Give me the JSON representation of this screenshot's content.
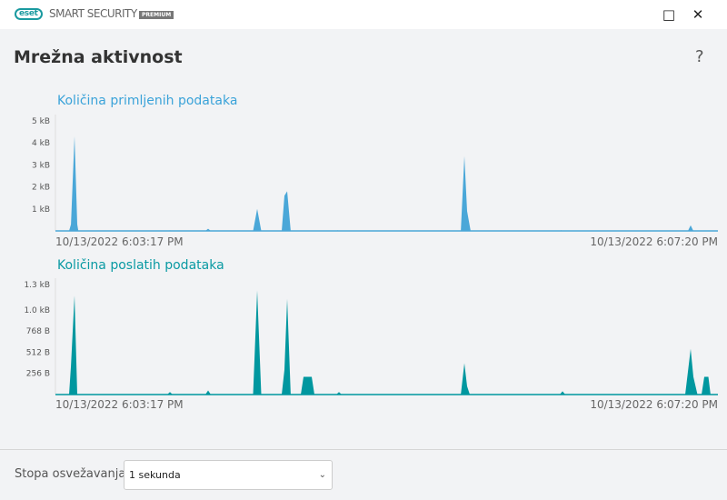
{
  "app": {
    "logo": "eset",
    "product": "SMART SECURITY",
    "edition": "PREMIUM",
    "maximize_icon": "□",
    "close_icon": "✕"
  },
  "page": {
    "title": "Mrežna aktivnost",
    "help": "?"
  },
  "footer": {
    "label": "Stopa osvežavanja",
    "select_value": "1 sekunda"
  },
  "colors": {
    "received": "#4aa7d8",
    "sent": "#00979f",
    "received_title": "#3ba3d9",
    "sent_title": "#0a9aa3"
  },
  "chart_data": [
    {
      "type": "area",
      "title": "Količina primljenih podataka",
      "unit": "kB",
      "x_unit": "seconds since start",
      "xlim": [
        0,
        243
      ],
      "ylim": [
        0,
        5
      ],
      "yticks": [
        {
          "v": 1,
          "label": "1 kB"
        },
        {
          "v": 2,
          "label": "2 kB"
        },
        {
          "v": 3,
          "label": "3 kB"
        },
        {
          "v": 4,
          "label": "4 kB"
        },
        {
          "v": 5,
          "label": "5 kB"
        }
      ],
      "x_start_label": "10/13/2022 6:03:17 PM",
      "x_end_label": "10/13/2022 6:07:20 PM",
      "points": [
        [
          0,
          0
        ],
        [
          5,
          0
        ],
        [
          5.7,
          0.3
        ],
        [
          7,
          4.3
        ],
        [
          8,
          0.3
        ],
        [
          8.4,
          0
        ],
        [
          41.5,
          0
        ],
        [
          42,
          0.03
        ],
        [
          42.5,
          0
        ],
        [
          55,
          0
        ],
        [
          56,
          0.1
        ],
        [
          57,
          0
        ],
        [
          72.5,
          0
        ],
        [
          74,
          1.0
        ],
        [
          75.5,
          0
        ],
        [
          83,
          0
        ],
        [
          84,
          1.6
        ],
        [
          85,
          1.8
        ],
        [
          86.3,
          0
        ],
        [
          103,
          0
        ],
        [
          103.5,
          0.03
        ],
        [
          104,
          0
        ],
        [
          148.7,
          0
        ],
        [
          150,
          3.4
        ],
        [
          151,
          0.9
        ],
        [
          152.3,
          0
        ],
        [
          185,
          0
        ],
        [
          185.5,
          0.03
        ],
        [
          186,
          0
        ],
        [
          232,
          0
        ],
        [
          233,
          0.25
        ],
        [
          234,
          0
        ],
        [
          243,
          0
        ]
      ]
    },
    {
      "type": "area",
      "title": "Količina poslatih podataka",
      "unit": "B",
      "x_unit": "seconds since start",
      "xlim": [
        0,
        243
      ],
      "ylim": [
        0,
        1331
      ],
      "yticks": [
        {
          "v": 256,
          "label": "256 B"
        },
        {
          "v": 512,
          "label": "512 B"
        },
        {
          "v": 768,
          "label": "768 B"
        },
        {
          "v": 1024,
          "label": "1.0 kB"
        },
        {
          "v": 1331,
          "label": "1.3 kB"
        }
      ],
      "x_start_label": "10/13/2022 6:03:17 PM",
      "x_end_label": "10/13/2022 6:07:20 PM",
      "points": [
        [
          0,
          0
        ],
        [
          5,
          0
        ],
        [
          5.7,
          350
        ],
        [
          7,
          1198
        ],
        [
          8,
          0.3
        ],
        [
          8.4,
          0
        ],
        [
          41,
          0
        ],
        [
          42,
          30
        ],
        [
          43,
          0
        ],
        [
          55,
          0
        ],
        [
          56,
          50
        ],
        [
          57,
          0
        ],
        [
          72.5,
          0
        ],
        [
          74,
          1260
        ],
        [
          75.5,
          0
        ],
        [
          83,
          0
        ],
        [
          84,
          300
        ],
        [
          85,
          1157
        ],
        [
          86.3,
          0
        ],
        [
          90,
          0
        ],
        [
          91,
          215
        ],
        [
          94,
          215
        ],
        [
          95,
          0
        ],
        [
          103,
          0
        ],
        [
          104,
          30
        ],
        [
          105,
          0
        ],
        [
          148.7,
          0
        ],
        [
          150,
          380
        ],
        [
          151,
          100
        ],
        [
          152,
          0
        ],
        [
          185,
          0
        ],
        [
          186,
          40
        ],
        [
          187,
          0
        ],
        [
          231,
          0
        ],
        [
          233,
          553
        ],
        [
          234,
          215
        ],
        [
          235.5,
          0
        ],
        [
          237,
          0
        ],
        [
          238,
          215
        ],
        [
          239.5,
          215
        ],
        [
          240.3,
          0
        ],
        [
          243,
          0
        ]
      ]
    }
  ]
}
